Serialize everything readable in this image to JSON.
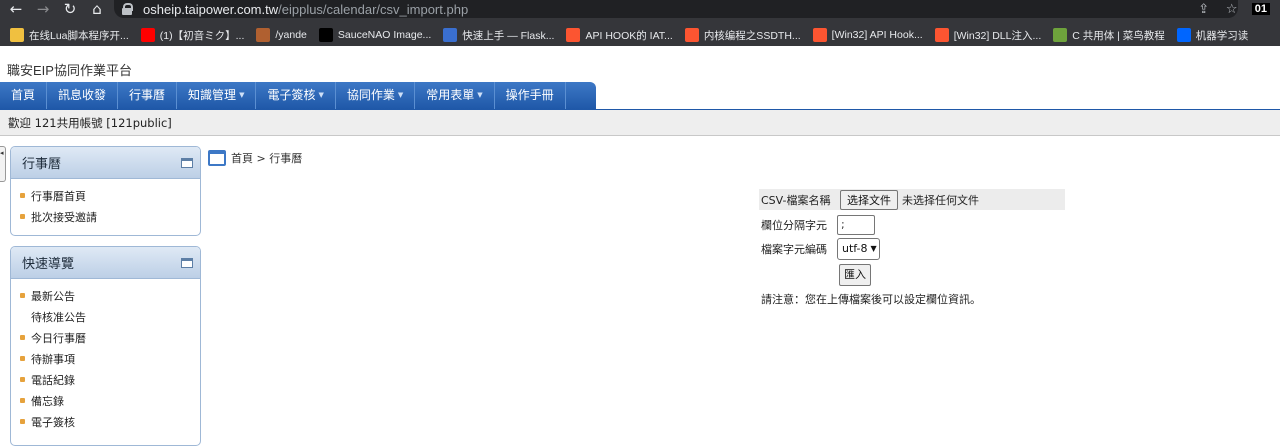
{
  "browser": {
    "url_host": "osheip.taipower.com.tw",
    "url_path": "/eipplus/calendar/csv_import.php",
    "profile_badge": "01",
    "bookmarks": [
      {
        "label": "在线Lua脚本程序开...",
        "icon": "bookmark-icon",
        "color": "#f0c040"
      },
      {
        "label": "(1)【初音ミク】...",
        "icon": "youtube-icon",
        "color": "#ff0000"
      },
      {
        "label": "/yande",
        "icon": "image-icon",
        "color": "#b06030"
      },
      {
        "label": "SauceNAO Image...",
        "icon": "x-icon",
        "color": "#000000"
      },
      {
        "label": "快速上手 — Flask...",
        "icon": "phone-icon",
        "color": "#3a6fd0"
      },
      {
        "label": "API HOOK的 IAT...",
        "icon": "csdn-icon",
        "color": "#fc5531"
      },
      {
        "label": "内核编程之SSDTH...",
        "icon": "csdn-icon",
        "color": "#fc5531"
      },
      {
        "label": "[Win32] API Hook...",
        "icon": "csdn-icon",
        "color": "#fc5531"
      },
      {
        "label": "[Win32] DLL注入...",
        "icon": "csdn-icon",
        "color": "#fc5531"
      },
      {
        "label": "C 共用体 | 菜鸟教程",
        "icon": "runoob-icon",
        "color": "#6ea33c"
      },
      {
        "label": "机器学习读",
        "icon": "zhihu-icon",
        "color": "#0066ff"
      }
    ]
  },
  "site": {
    "title": "職安EIP協同作業平台",
    "menu": [
      {
        "label": "首頁",
        "dropdown": false
      },
      {
        "label": "訊息收發",
        "dropdown": false
      },
      {
        "label": "行事曆",
        "dropdown": false
      },
      {
        "label": "知識管理",
        "dropdown": true
      },
      {
        "label": "電子簽核",
        "dropdown": true
      },
      {
        "label": "協同作業",
        "dropdown": true
      },
      {
        "label": "常用表單",
        "dropdown": true
      },
      {
        "label": "操作手冊",
        "dropdown": false
      }
    ],
    "welcome": "歡迎 121共用帳號 [121public]"
  },
  "sidebar": {
    "calendar_panel": {
      "title": "行事曆",
      "items": [
        {
          "label": "行事曆首頁",
          "bullet": true
        },
        {
          "label": "批次接受邀請",
          "bullet": true
        }
      ]
    },
    "quick_panel": {
      "title": "快速導覽",
      "items": [
        {
          "label": "最新公告",
          "bullet": true
        },
        {
          "label": "待核准公告",
          "bullet": false
        },
        {
          "label": "今日行事曆",
          "bullet": true
        },
        {
          "label": "待辦事項",
          "bullet": true
        },
        {
          "label": "電話紀錄",
          "bullet": true
        },
        {
          "label": "備忘錄",
          "bullet": true
        },
        {
          "label": "電子簽核",
          "bullet": true
        }
      ]
    }
  },
  "breadcrumb": "首頁 > 行事曆",
  "form": {
    "file_label": "CSV-檔案名稱",
    "file_button": "选择文件",
    "file_status": "未选择任何文件",
    "sep_label": "欄位分隔字元",
    "sep_value": ";",
    "enc_label": "檔案字元編碼",
    "enc_value": "utf-8",
    "submit_label": "匯入",
    "note": "請注意：您在上傳檔案後可以設定欄位資訊。"
  }
}
